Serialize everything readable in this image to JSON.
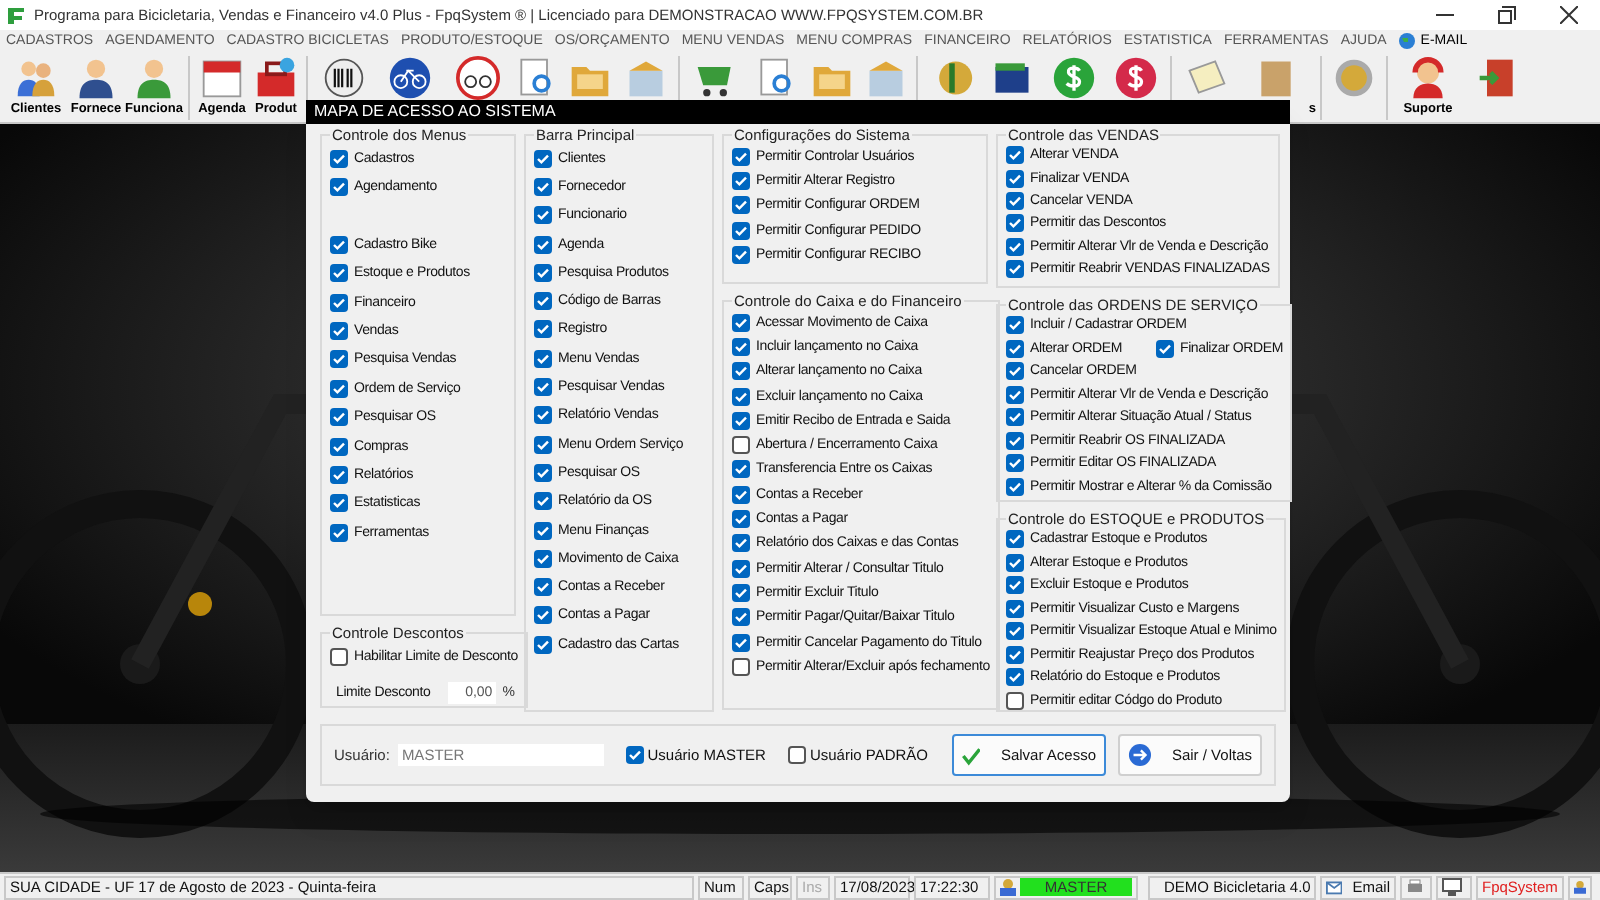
{
  "window": {
    "title": "Programa para Bicicletaria, Vendas e Financeiro v4.0 Plus - FpqSystem ® | Licenciado para  DEMONSTRACAO WWW.FPQSYSTEM.COM.BR"
  },
  "menu": [
    "CADASTROS",
    "AGENDAMENTO",
    "CADASTRO BICICLETAS",
    "PRODUTO/ESTOQUE",
    "OS/ORÇAMENTO",
    "MENU VENDAS",
    "MENU COMPRAS",
    "FINANCEIRO",
    "RELATÓRIOS",
    "ESTATISTICA",
    "FERRAMENTAS",
    "AJUDA",
    "E-MAIL"
  ],
  "toolbar_labels": [
    "Clientes",
    "Fornece",
    "Funciona",
    "Agenda",
    "Produt",
    "s",
    "Suporte"
  ],
  "dialog": {
    "title": "MAPA DE ACESSO AO SISTEMA",
    "columns": [
      [
        {
          "title": "Controle dos Menus",
          "items": [
            {
              "kind": "checkbox",
              "label": "Cadastros",
              "checked": true
            },
            {
              "kind": "checkbox",
              "label": "Agendamento",
              "checked": true
            },
            {
              "kind": "spacer"
            },
            {
              "kind": "checkbox",
              "label": "Cadastro Bike",
              "checked": true
            },
            {
              "kind": "checkbox",
              "label": "Estoque e Produtos",
              "checked": true
            },
            {
              "kind": "checkbox",
              "label": "Financeiro",
              "checked": true
            },
            {
              "kind": "checkbox",
              "label": "Vendas",
              "checked": true
            },
            {
              "kind": "checkbox",
              "label": "Pesquisa Vendas",
              "checked": true
            },
            {
              "kind": "checkbox",
              "label": "Ordem de Serviço",
              "checked": true
            },
            {
              "kind": "checkbox",
              "label": "Pesquisar OS",
              "checked": true
            },
            {
              "kind": "checkbox",
              "label": "Compras",
              "checked": true
            },
            {
              "kind": "checkbox",
              "label": "Relatórios",
              "checked": true
            },
            {
              "kind": "checkbox",
              "label": "Estatisticas",
              "checked": true
            },
            {
              "kind": "checkbox",
              "label": "Ferramentas",
              "checked": true
            }
          ]
        },
        {
          "title": "Controle Descontos",
          "items": [
            {
              "kind": "checkbox",
              "label": "Habilitar Limite de Desconto",
              "checked": false
            },
            {
              "kind": "field",
              "label": "Limite Desconto",
              "value": "0,00",
              "unit": "%"
            }
          ]
        }
      ],
      [
        {
          "title": "Barra Principal",
          "items": [
            {
              "kind": "checkbox",
              "label": "Clientes",
              "checked": true
            },
            {
              "kind": "checkbox",
              "label": "Fornecedor",
              "checked": true
            },
            {
              "kind": "checkbox",
              "label": "Funcionario",
              "checked": true
            },
            {
              "kind": "checkbox",
              "label": "Agenda",
              "checked": true
            },
            {
              "kind": "checkbox",
              "label": "Pesquisa Produtos",
              "checked": true
            },
            {
              "kind": "checkbox",
              "label": "Código de Barras",
              "checked": true
            },
            {
              "kind": "checkbox",
              "label": "Registro",
              "checked": true
            },
            {
              "kind": "checkbox",
              "label": "Menu Vendas",
              "checked": true
            },
            {
              "kind": "checkbox",
              "label": "Pesquisar Vendas",
              "checked": true
            },
            {
              "kind": "checkbox",
              "label": "Relatório Vendas",
              "checked": true
            },
            {
              "kind": "checkbox",
              "label": "Menu Ordem Serviço",
              "checked": true
            },
            {
              "kind": "checkbox",
              "label": "Pesquisar OS",
              "checked": true
            },
            {
              "kind": "checkbox",
              "label": "Relatório da OS",
              "checked": true
            },
            {
              "kind": "checkbox",
              "label": "Menu Finanças",
              "checked": true
            },
            {
              "kind": "checkbox",
              "label": "Movimento de Caixa",
              "checked": true
            },
            {
              "kind": "checkbox",
              "label": "Contas a Receber",
              "checked": true
            },
            {
              "kind": "checkbox",
              "label": "Contas a Pagar",
              "checked": true
            },
            {
              "kind": "checkbox",
              "label": "Cadastro das Cartas",
              "checked": true
            }
          ]
        }
      ],
      [
        {
          "title": "Configurações do Sistema",
          "items": [
            {
              "kind": "checkbox",
              "label": "Permitir Controlar Usuários",
              "checked": true
            },
            {
              "kind": "checkbox",
              "label": "Permitir Alterar Registro",
              "checked": true
            },
            {
              "kind": "checkbox",
              "label": "Permitir Configurar ORDEM",
              "checked": true
            },
            {
              "kind": "checkbox",
              "label": "Permitir Configurar PEDIDO",
              "checked": true
            },
            {
              "kind": "checkbox",
              "label": "Permitir Configurar RECIBO",
              "checked": true
            }
          ]
        },
        {
          "title": "Controle do Caixa e do Financeiro",
          "items": [
            {
              "kind": "checkbox",
              "label": "Acessar Movimento de Caixa",
              "checked": true
            },
            {
              "kind": "checkbox",
              "label": "Incluir lançamento no Caixa",
              "checked": true
            },
            {
              "kind": "checkbox",
              "label": "Alterar lançamento no Caixa",
              "checked": true
            },
            {
              "kind": "checkbox",
              "label": "Excluir lançamento no Caixa",
              "checked": true
            },
            {
              "kind": "checkbox",
              "label": "Emitir Recibo de Entrada e Saida",
              "checked": true
            },
            {
              "kind": "checkbox",
              "label": "Abertura / Encerramento Caixa",
              "checked": false
            },
            {
              "kind": "checkbox",
              "label": "Transferencia Entre os Caixas",
              "checked": true
            },
            {
              "kind": "checkbox",
              "label": "Contas a Receber",
              "checked": true
            },
            {
              "kind": "checkbox",
              "label": "Contas a Pagar",
              "checked": true
            },
            {
              "kind": "checkbox",
              "label": "Relatório dos Caixas e das Contas",
              "checked": true
            },
            {
              "kind": "checkbox",
              "label": "Permitir Alterar / Consultar Titulo",
              "checked": true
            },
            {
              "kind": "checkbox",
              "label": "Permitir Excluir Titulo",
              "checked": true
            },
            {
              "kind": "checkbox",
              "label": "Permitir Pagar/Quitar/Baixar Titulo",
              "checked": true
            },
            {
              "kind": "checkbox",
              "label": "Permitir Cancelar Pagamento do Titulo",
              "checked": true
            },
            {
              "kind": "checkbox",
              "label": "Permitir Alterar/Excluir após fechamento",
              "checked": false
            }
          ]
        }
      ],
      [
        {
          "title": "Controle das VENDAS",
          "items": [
            {
              "kind": "checkbox",
              "label": "Alterar VENDA",
              "checked": true
            },
            {
              "kind": "checkbox",
              "label": "Finalizar VENDA",
              "checked": true
            },
            {
              "kind": "checkbox",
              "label": "Cancelar VENDA",
              "checked": true
            },
            {
              "kind": "checkbox",
              "label": "Permitir das Descontos",
              "checked": true
            },
            {
              "kind": "checkbox",
              "label": "Permitir Alterar Vlr de Venda e Descrição",
              "checked": true
            },
            {
              "kind": "checkbox",
              "label": "Permitir Reabrir VENDAS FINALIZADAS",
              "checked": true
            }
          ]
        },
        {
          "title": "Controle das ORDENS DE SERVIÇO",
          "items": [
            {
              "kind": "checkbox",
              "label": "Incluir / Cadastrar ORDEM",
              "checked": true
            },
            {
              "kind": "pair",
              "label": "Alterar ORDEM",
              "checked": true,
              "second_label": "Finalizar ORDEM",
              "second_checked": true
            },
            {
              "kind": "checkbox",
              "label": "Cancelar ORDEM",
              "checked": true
            },
            {
              "kind": "checkbox",
              "label": "Permitir Alterar Vlr de Venda e Descrição",
              "checked": true
            },
            {
              "kind": "checkbox",
              "label": "Permitir Alterar Situação Atual / Status",
              "checked": true
            },
            {
              "kind": "checkbox",
              "label": "Permitir Reabrir OS FINALIZADA",
              "checked": true
            },
            {
              "kind": "checkbox",
              "label": "Permitir Editar OS FINALIZADA",
              "checked": true
            },
            {
              "kind": "checkbox",
              "label": "Permitir Mostrar e Alterar % da Comissão",
              "checked": true
            }
          ]
        },
        {
          "title": "Controle do ESTOQUE e PRODUTOS",
          "items": [
            {
              "kind": "checkbox",
              "label": "Cadastrar Estoque e Produtos",
              "checked": true
            },
            {
              "kind": "checkbox",
              "label": "Alterar Estoque e Produtos",
              "checked": true
            },
            {
              "kind": "checkbox",
              "label": "Excluir Estoque e Produtos",
              "checked": true
            },
            {
              "kind": "checkbox",
              "label": "Permitir Visualizar Custo e Margens",
              "checked": true
            },
            {
              "kind": "checkbox",
              "label": "Permitir Visualizar Estoque Atual e Minimo",
              "checked": true
            },
            {
              "kind": "checkbox",
              "label": "Permitir Reajustar Preço dos Produtos",
              "checked": true
            },
            {
              "kind": "checkbox",
              "label": "Relatório do Estoque e Produtos",
              "checked": true
            },
            {
              "kind": "checkbox",
              "label": "Permitir editar Códgo do Produto",
              "checked": false
            }
          ]
        }
      ]
    ],
    "user": {
      "label": "Usuário:",
      "value": "MASTER"
    },
    "user_types": [
      {
        "label": "Usuário MASTER",
        "checked": true
      },
      {
        "label": "Usuário PADRÃO",
        "checked": false
      }
    ],
    "buttons": [
      {
        "label": "Salvar Acesso",
        "kind": "save",
        "focused": true
      },
      {
        "label": "Sair / Voltas",
        "kind": "exit",
        "focused": false
      }
    ]
  },
  "status_bar": [
    {
      "kind": "text",
      "text": "SUA CIDADE - UF 17 de Agosto de 2023 - Quinta-feira"
    },
    {
      "kind": "text",
      "text": "Num"
    },
    {
      "kind": "text",
      "text": "Caps"
    },
    {
      "kind": "text",
      "text": "Ins",
      "disabled": true
    },
    {
      "kind": "text",
      "text": "17/08/2023"
    },
    {
      "kind": "text",
      "text": "17:22:30"
    },
    {
      "kind": "user",
      "text": "MASTER"
    },
    {
      "kind": "app",
      "text": "DEMO Bicicletaria 4.0"
    },
    {
      "kind": "email",
      "text": "Email"
    },
    {
      "kind": "icons"
    },
    {
      "kind": "brand",
      "text": "FpqSystem"
    },
    {
      "kind": "end"
    }
  ]
}
